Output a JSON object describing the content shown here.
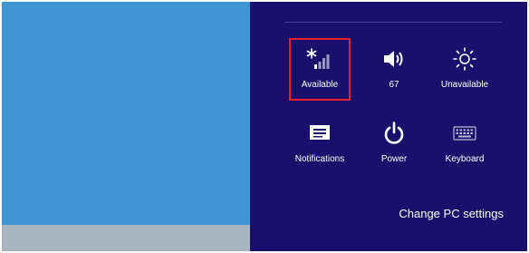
{
  "charm": {
    "tiles_row1": [
      {
        "label": "Available",
        "icon": "wifi-signal-icon"
      },
      {
        "label": "67",
        "icon": "volume-icon"
      },
      {
        "label": "Unavailable",
        "icon": "brightness-icon"
      }
    ],
    "tiles_row2": [
      {
        "label": "Notifications",
        "icon": "notifications-icon"
      },
      {
        "label": "Power",
        "icon": "power-icon"
      },
      {
        "label": "Keyboard",
        "icon": "keyboard-icon"
      }
    ],
    "change_pc_settings": "Change PC settings"
  },
  "colors": {
    "desktop": "#3f95d4",
    "taskbar": "#aab6bf",
    "charm_background": "#1a0f6a",
    "highlight": "#e8202a"
  }
}
